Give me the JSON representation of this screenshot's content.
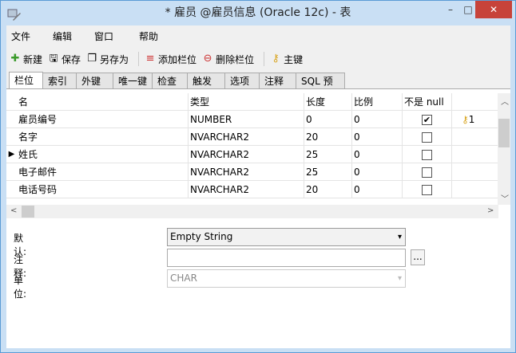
{
  "window": {
    "title": "* 雇员 @雇员信息 (Oracle 12c) - 表",
    "minimize": "–",
    "maximize": "□",
    "close": "✕"
  },
  "menu": [
    "文件",
    "编辑",
    "窗口",
    "帮助"
  ],
  "toolbar": {
    "new": "新建",
    "save": "保存",
    "save_as": "另存为",
    "add_column": "添加栏位",
    "delete_column": "删除栏位",
    "primary_key": "主键"
  },
  "tabs": [
    "栏位",
    "索引",
    "外键",
    "唯一键",
    "检查",
    "触发器",
    "选项",
    "注释",
    "SQL 预览"
  ],
  "grid": {
    "headers": [
      "名",
      "类型",
      "长度",
      "比例",
      "不是 null",
      ""
    ],
    "rows": [
      {
        "name": "雇员编号",
        "type": "NUMBER",
        "length": "0",
        "scale": "0",
        "not_null": true,
        "key": "1",
        "current": false
      },
      {
        "name": "名字",
        "type": "NVARCHAR2",
        "length": "20",
        "scale": "0",
        "not_null": false,
        "key": "",
        "current": false
      },
      {
        "name": "姓氏",
        "type": "NVARCHAR2",
        "length": "25",
        "scale": "0",
        "not_null": false,
        "key": "",
        "current": true
      },
      {
        "name": "电子邮件",
        "type": "NVARCHAR2",
        "length": "25",
        "scale": "0",
        "not_null": false,
        "key": "",
        "current": false
      },
      {
        "name": "电话号码",
        "type": "NVARCHAR2",
        "length": "20",
        "scale": "0",
        "not_null": false,
        "key": "",
        "current": false
      }
    ]
  },
  "form": {
    "default_label": "默认:",
    "default_value": "Empty String",
    "comment_label": "注释:",
    "comment_value": "",
    "browse_label": "...",
    "unit_label": "单位:",
    "unit_value": "CHAR"
  }
}
